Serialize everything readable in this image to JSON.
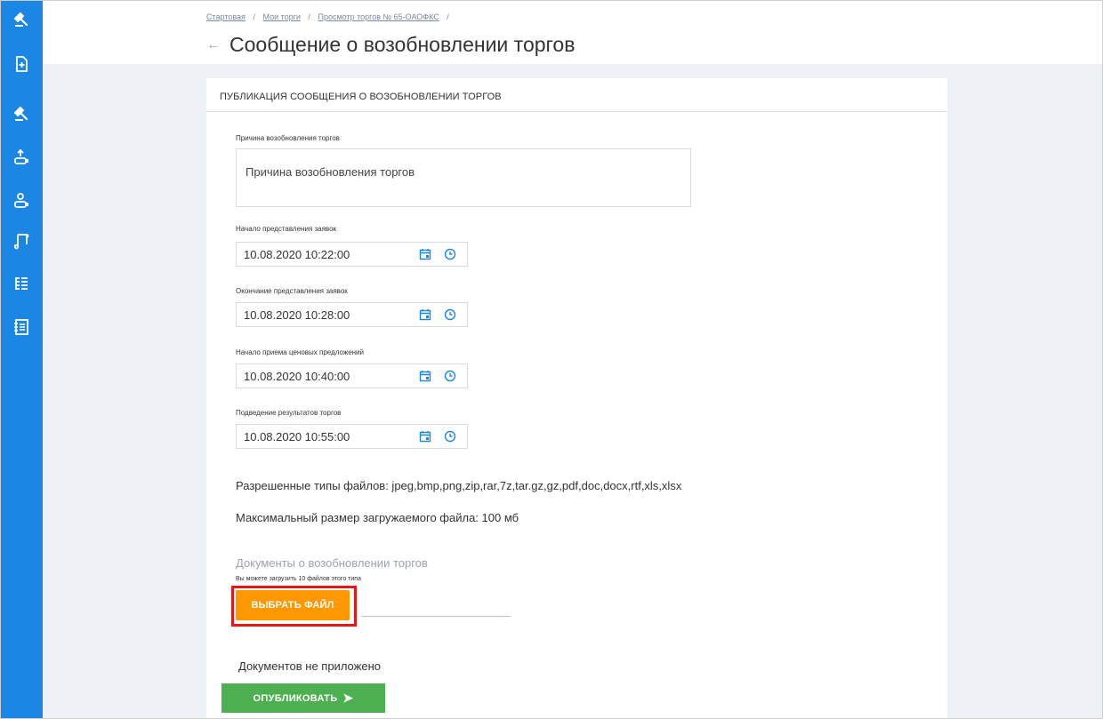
{
  "sidebar": {
    "icons": [
      "gavel-icon",
      "document-plus-icon",
      "gavel-icon",
      "user-upload-icon",
      "user-download-icon",
      "scroll-icon",
      "list-icon",
      "contacts-icon"
    ]
  },
  "breadcrumb": {
    "items": [
      "Стартовая",
      "Мои торги",
      "Просмотр торгов № 65-ОАОФКС"
    ],
    "separator": "/"
  },
  "header": {
    "title": "Сообщение о возобновлении торгов",
    "back_arrow": "←"
  },
  "card": {
    "title": "ПУБЛИКАЦИЯ СООБЩЕНИЯ О ВОЗОБНОВЛЕНИИ ТОРГОВ"
  },
  "form": {
    "reason_label": "Причина возобновления торгов",
    "reason_placeholder": "Причина возобновления торгов",
    "fields": [
      {
        "label": "Начало представления заявок",
        "value": "10.08.2020 10:22:00"
      },
      {
        "label": "Окончание представления заявок",
        "value": "10.08.2020 10:28:00"
      },
      {
        "label": "Начало приема ценовых предложений",
        "value": "10.08.2020 10:40:00"
      },
      {
        "label": "Подведение результатов торгов",
        "value": "10.08.2020 10:55:00"
      }
    ],
    "allowed_types": "Разрешенные типы файлов: jpeg,bmp,png,zip,rar,7z,tar.gz,gz,pdf,doc,docx,rtf,xls,xlsx",
    "max_size": "Максимальный размер загружаемого файла: 100 мб",
    "docs_title": "Документы о возобновлении торгов",
    "docs_hint": "Вы можете загрузить 10 файлов этого типа",
    "select_file_label": "ВЫБРАТЬ ФАЙЛ",
    "no_docs": "Документов не приложено",
    "publish_label": "ОПУБЛИКОВАТЬ",
    "publish_arrow": "➤"
  },
  "colors": {
    "sidebar": "#1c86e4",
    "accent_orange": "#ff9800",
    "accent_green": "#4caf50",
    "highlight_red": "#e8161b",
    "icon_blue": "#1c86e4"
  }
}
